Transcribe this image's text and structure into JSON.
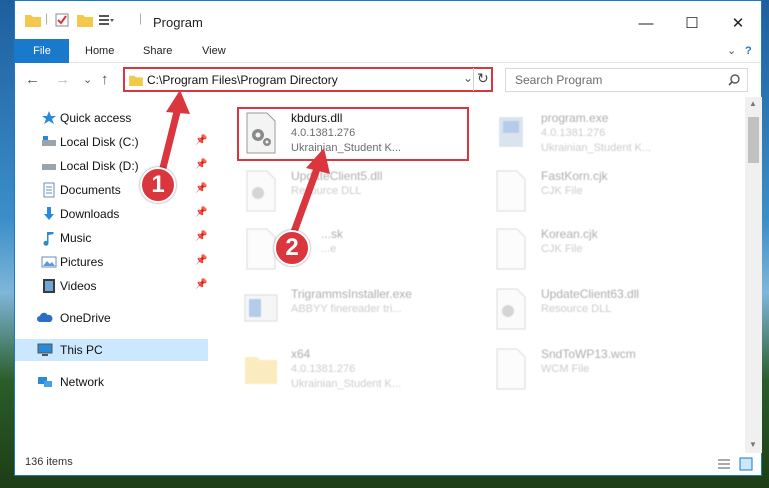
{
  "window": {
    "title": "Program",
    "controls": {
      "minimize": "—",
      "maximize": "☐",
      "close": "✕"
    }
  },
  "ribbon": {
    "tabs": [
      "File",
      "Home",
      "Share",
      "View"
    ],
    "help": "?"
  },
  "navigation": {
    "back": "←",
    "forward": "→",
    "recent": "⌄",
    "up": "↑",
    "address": "C:\\Program Files\\Program Directory",
    "refresh": "↻",
    "search_placeholder": "Search Program"
  },
  "sidebar": {
    "items": [
      {
        "label": "Quick access",
        "icon": "star-icon",
        "pinned": false,
        "selected": false
      },
      {
        "label": "Local Disk (C:)",
        "icon": "drive-icon",
        "pinned": true,
        "selected": false
      },
      {
        "label": "Local Disk (D:)",
        "icon": "drive-icon",
        "pinned": true,
        "selected": false
      },
      {
        "label": "Documents",
        "icon": "documents-icon",
        "pinned": true,
        "selected": false
      },
      {
        "label": "Downloads",
        "icon": "download-icon",
        "pinned": true,
        "selected": false
      },
      {
        "label": "Music",
        "icon": "music-icon",
        "pinned": true,
        "selected": false
      },
      {
        "label": "Pictures",
        "icon": "pictures-icon",
        "pinned": true,
        "selected": false
      },
      {
        "label": "Videos",
        "icon": "videos-icon",
        "pinned": true,
        "selected": false
      },
      {
        "label": "OneDrive",
        "icon": "cloud-icon",
        "pinned": false,
        "selected": false
      },
      {
        "label": "This PC",
        "icon": "computer-icon",
        "pinned": false,
        "selected": true
      },
      {
        "label": "Network",
        "icon": "network-icon",
        "pinned": false,
        "selected": false
      }
    ]
  },
  "files": [
    {
      "name": "kbdurs.dll",
      "line2": "4.0.1381.276",
      "line3": "Ukrainian_Student K...",
      "icon": "dll-gear-icon",
      "highlighted": true
    },
    {
      "name": "program.exe",
      "line2": "4.0.1381.276",
      "line3": "Ukrainian_Student K...",
      "icon": "exe-icon",
      "highlighted": false
    },
    {
      "name": "UpdateClient5.dll",
      "line2": "Resource DLL",
      "line3": "",
      "icon": "dll-gear-icon",
      "highlighted": false
    },
    {
      "name": "FastKorn.cjk",
      "line2": "CJK File",
      "line3": "",
      "icon": "blank-file-icon",
      "highlighted": false
    },
    {
      "name": "...sk",
      "line2": "...e",
      "line3": "",
      "icon": "blank-file-icon",
      "highlighted": false
    },
    {
      "name": "Korean.cjk",
      "line2": "CJK File",
      "line3": "",
      "icon": "blank-file-icon",
      "highlighted": false
    },
    {
      "name": "TrigrammsInstaller.exe",
      "line2": "ABBYY finereader tri...",
      "line3": "",
      "icon": "installer-icon",
      "highlighted": false
    },
    {
      "name": "UpdateClient63.dll",
      "line2": "Resource DLL",
      "line3": "",
      "icon": "dll-gear-icon",
      "highlighted": false
    },
    {
      "name": "x64",
      "line2": "4.0.1381.276",
      "line3": "Ukrainian_Student K...",
      "icon": "folder-icon",
      "highlighted": false
    },
    {
      "name": "SndToWP13.wcm",
      "line2": "WCM File",
      "line3": "",
      "icon": "blank-file-icon",
      "highlighted": false
    }
  ],
  "status": {
    "item_count": "136 items"
  },
  "annotations": [
    {
      "label": "1"
    },
    {
      "label": "2"
    }
  ],
  "colors": {
    "accent": "#1979ca",
    "highlight": "#d9363e",
    "selected_bg": "#cce8ff"
  }
}
